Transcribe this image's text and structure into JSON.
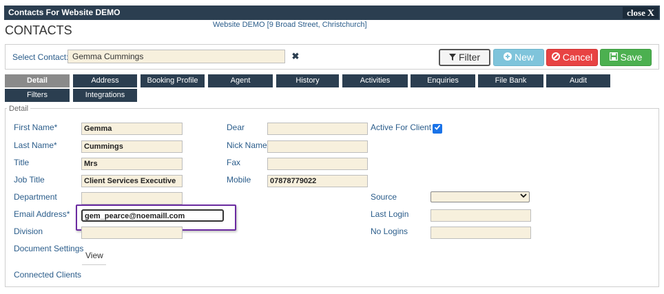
{
  "window": {
    "title": "Contacts For Website DEMO",
    "close_label": "close",
    "close_glyph": "X"
  },
  "page_title": "CONTACTS",
  "site_info": "Website DEMO [9 Broad Street, Christchurch]",
  "select_contact": {
    "label": "Select Contact:",
    "value": "Gemma Cummings",
    "clear_glyph": "✖"
  },
  "buttons": {
    "filter": "Filter",
    "new": "New",
    "cancel": "Cancel",
    "save": "Save"
  },
  "tabs": [
    "Detail",
    "Address",
    "Booking Profile",
    "Agent",
    "History",
    "Activities",
    "Enquiries",
    "File Bank",
    "Audit",
    "Filters",
    "Integrations"
  ],
  "section_legend": "Detail",
  "fields": {
    "first_name": {
      "label": "First Name*",
      "value": "Gemma"
    },
    "last_name": {
      "label": "Last Name*",
      "value": "Cummings"
    },
    "title": {
      "label": "Title",
      "value": "Mrs"
    },
    "job_title": {
      "label": "Job Title",
      "value": "Client Services Executive"
    },
    "department": {
      "label": "Department",
      "value": ""
    },
    "email": {
      "label": "Email Address*",
      "value": "gem_pearce@noemaill.com"
    },
    "division": {
      "label": "Division",
      "value": ""
    },
    "document_settings": {
      "label": "Document Settings",
      "link": "View"
    },
    "connected_clients": {
      "label": "Connected Clients"
    },
    "dear": {
      "label": "Dear",
      "value": ""
    },
    "nick_name": {
      "label": "Nick Name",
      "value": ""
    },
    "fax": {
      "label": "Fax",
      "value": ""
    },
    "mobile": {
      "label": "Mobile",
      "value": "07878779022"
    },
    "active_for_client": {
      "label": "Active For Client",
      "checked": true
    },
    "source": {
      "label": "Source",
      "value": ""
    },
    "last_login": {
      "label": "Last Login",
      "value": ""
    },
    "no_logins": {
      "label": "No Logins",
      "value": ""
    }
  },
  "colors": {
    "tab_bg": "#2b3e50",
    "tab_active_bg": "#8a8a8a",
    "field_bg": "#f7f0dd",
    "label_color": "#2a5c8a",
    "highlight": "#6a2aa0"
  }
}
